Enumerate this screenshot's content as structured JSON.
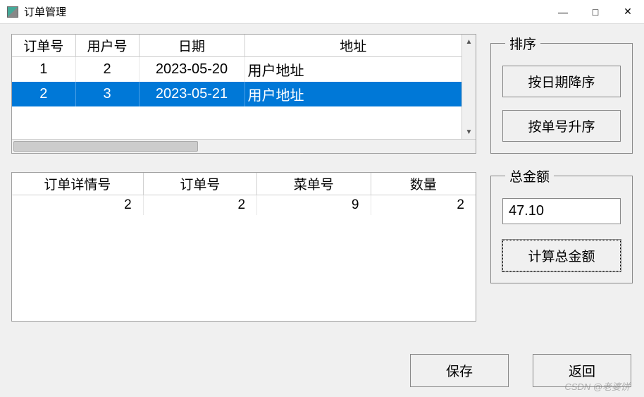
{
  "window": {
    "title": "订单管理"
  },
  "orders_table": {
    "headers": [
      "订单号",
      "用户号",
      "日期",
      "地址"
    ],
    "rows": [
      {
        "order_id": "1",
        "user_id": "2",
        "date": "2023-05-20",
        "address": "用户地址",
        "selected": false
      },
      {
        "order_id": "2",
        "user_id": "3",
        "date": "2023-05-21",
        "address": "用户地址",
        "selected": true
      }
    ]
  },
  "details_table": {
    "headers": [
      "订单详情号",
      "订单号",
      "菜单号",
      "数量"
    ],
    "rows": [
      {
        "detail_id": "2",
        "order_id": "2",
        "menu_id": "9",
        "qty": "2"
      }
    ]
  },
  "sort_group": {
    "legend": "排序",
    "by_date_desc": "按日期降序",
    "by_id_asc": "按单号升序"
  },
  "total_group": {
    "legend": "总金额",
    "value": "47.10",
    "calc_label": "计算总金额"
  },
  "buttons": {
    "save": "保存",
    "back": "返回"
  },
  "watermark": "CSDN @老婆饼"
}
